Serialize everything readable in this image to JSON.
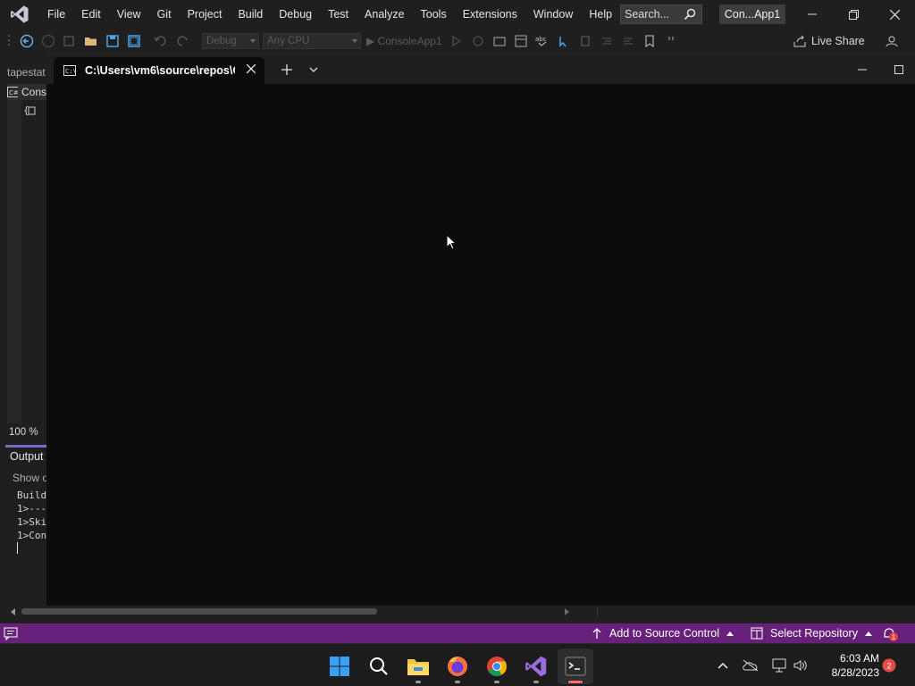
{
  "vs": {
    "menu": [
      "File",
      "Edit",
      "View",
      "Git",
      "Project",
      "Build",
      "Debug",
      "Test",
      "Analyze",
      "Tools",
      "Extensions",
      "Window",
      "Help"
    ],
    "search_label": "Search...",
    "title_badge": "Con...App1",
    "toolbar": {
      "config": "Debug",
      "platform": "Any CPU",
      "run_target": "ConsoleApp1",
      "live_share": "Live Share"
    },
    "left_panel": {
      "tab_label": "tapestat",
      "solution_item": "Cons",
      "zoom": "100 %",
      "output_title": "Output",
      "output_show": "Show o",
      "output_lines": [
        "Build",
        "1>---",
        "1>Ski",
        "1>Con"
      ]
    },
    "statusbar": {
      "add_source_control": "Add to Source Control",
      "select_repository": "Select Repository",
      "notification_count": "1",
      "accent": "#68217a"
    }
  },
  "terminal": {
    "tab_title": "C:\\Users\\vm6\\source\\repos\\C",
    "background": "#0c0c0c"
  },
  "taskbar": {
    "apps": [
      {
        "name": "start-button",
        "icon": "windows-icon"
      },
      {
        "name": "search-button",
        "icon": "search-icon"
      },
      {
        "name": "file-explorer",
        "icon": "folder-icon"
      },
      {
        "name": "firefox",
        "icon": "firefox-icon"
      },
      {
        "name": "chrome",
        "icon": "chrome-icon"
      },
      {
        "name": "visual-studio",
        "icon": "visual-studio-icon"
      },
      {
        "name": "terminal",
        "icon": "terminal-icon"
      }
    ],
    "time": "6:03 AM",
    "date": "8/28/2023",
    "notification_badge": "2"
  }
}
